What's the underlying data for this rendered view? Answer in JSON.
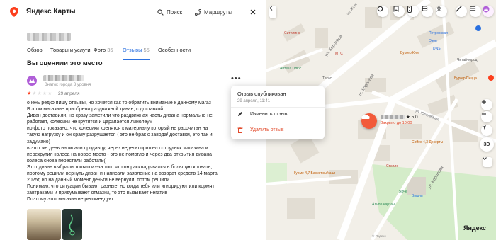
{
  "app": {
    "title": "Яндекс Карты"
  },
  "header": {
    "search_label": "Поиск",
    "routes_label": "Маршруты"
  },
  "tabs": [
    {
      "label": "Обзор",
      "count": ""
    },
    {
      "label": "Товары и услуги",
      "count": ""
    },
    {
      "label": "Фото",
      "count": "35"
    },
    {
      "label": "Отзывы",
      "count": "55"
    },
    {
      "label": "Особенности",
      "count": ""
    }
  ],
  "active_tab": "Отзывы",
  "section_title": "Вы оценили это место",
  "review": {
    "author_badge": "Знаток города 3 уровня",
    "rating": 1,
    "rating_max": 5,
    "date": "29 апреля",
    "lines": [
      "очень редко пишу отзывы, но хочется как то обратить внимание к данному магаз",
      "В этом магазине приобрели раздвижной диван, с доставкой",
      "Диван доставили, но сразу заметили что раздвижная часть дивана нормально не",
      "работает, колесики не крутятся и царапается линолеум",
      "но фото показано, что колесики крепятся к материалу который не рассчитан на",
      "такую нагрузку и он сразу разрушается ( это не брак с завода/ доставки, это так и",
      "задумано)",
      "в этот же день написали продавцу, через неделю пришел сотрудник магазина и",
      "перекрутил колеса на новое место - это не помогло и через два открытия дивана",
      "колеса снова перестали работать(",
      "Этот диван выбрали только из-за того что он раскладывался в большую кровать,",
      "поэтому решили вернуть диван и написали заявление на возврат средств 14 марта",
      "2025г, но на данный момент деньги не вернули, потом решили",
      "Понимаю, что ситуации бывают разные, но когда тебя или игнорируют или кормят",
      "завтраками и придумывают отмазки, то это вызывает негатив",
      "Поэтому этот магазин не рекомендую"
    ]
  },
  "popup": {
    "title": "Отзыв опубликован",
    "date": "29 апреля, 11:41",
    "edit_label": "Изменить отзыв",
    "delete_label": "Удалить отзыв"
  },
  "map": {
    "street_1": "ул. Королёва",
    "street_2": "ул. Королёва",
    "street_3": "ул. Королёва",
    "street_4": "ул. Жуко",
    "street_5": "ул. Юбилейная",
    "place_rating": "★ 5,0",
    "place_hours": "Закрыто до 10:00",
    "zoom": "3D",
    "copyright": "© Яндекс",
    "brand": "Яндекс",
    "pois": [
      {
        "name": "Ситилинк"
      },
      {
        "name": "МТС"
      },
      {
        "name": "Аптека Плюс"
      },
      {
        "name": "Текас"
      },
      {
        "name": "Петровская"
      },
      {
        "name": "Озон"
      },
      {
        "name": "DNS"
      },
      {
        "name": "Бургер Кинг"
      },
      {
        "name": "Читай-город"
      },
      {
        "name": "Бургер Пицца"
      },
      {
        "name": "Coffee 4,3 Десерты"
      },
      {
        "name": "Стелло"
      },
      {
        "name": "Ярче"
      },
      {
        "name": "Гурме 4,7 Банкетный зал"
      },
      {
        "name": "Альпе нарзан"
      },
      {
        "name": "Вишня"
      }
    ]
  },
  "colors": {
    "accent": "#2a70e0",
    "star": "#fc3f1d",
    "danger": "#e24a2b",
    "marker": "#f25a3a"
  }
}
